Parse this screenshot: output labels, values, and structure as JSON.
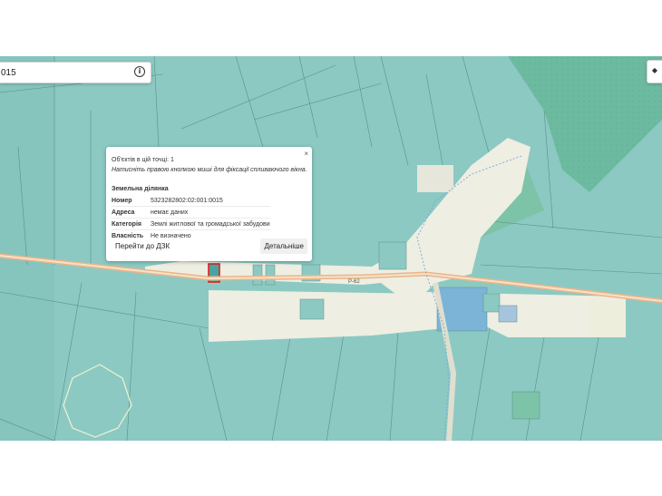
{
  "search": {
    "value": "015"
  },
  "icons": {
    "info": "info-icon",
    "layers": "layers-icon",
    "close": "close-icon"
  },
  "map": {
    "road_label": "Р-62",
    "colors": {
      "parcel": "#8cc9c3",
      "forest": "#6cbba0",
      "settlement": "#f0f0e6",
      "road": "#e9b58a",
      "selected": "#e02020"
    }
  },
  "popup": {
    "close_glyph": "×",
    "count_text": "Об'єктів в цій точці: 1",
    "hint": "Натисніть правою кнопкою миші для фіксації спливаючого вікна.",
    "section_title": "Земельна ділянка",
    "rows": [
      {
        "label": "Номер",
        "value": "5323282802:02:001:0015"
      },
      {
        "label": "Адреса",
        "value": "немає даних"
      },
      {
        "label": "Категорія",
        "value": "Землі житлової та громадської забудови"
      },
      {
        "label": "Власність",
        "value": "Не визначено"
      }
    ],
    "link_dzk": "Перейти до ДЗК",
    "details": "Детальніше"
  }
}
